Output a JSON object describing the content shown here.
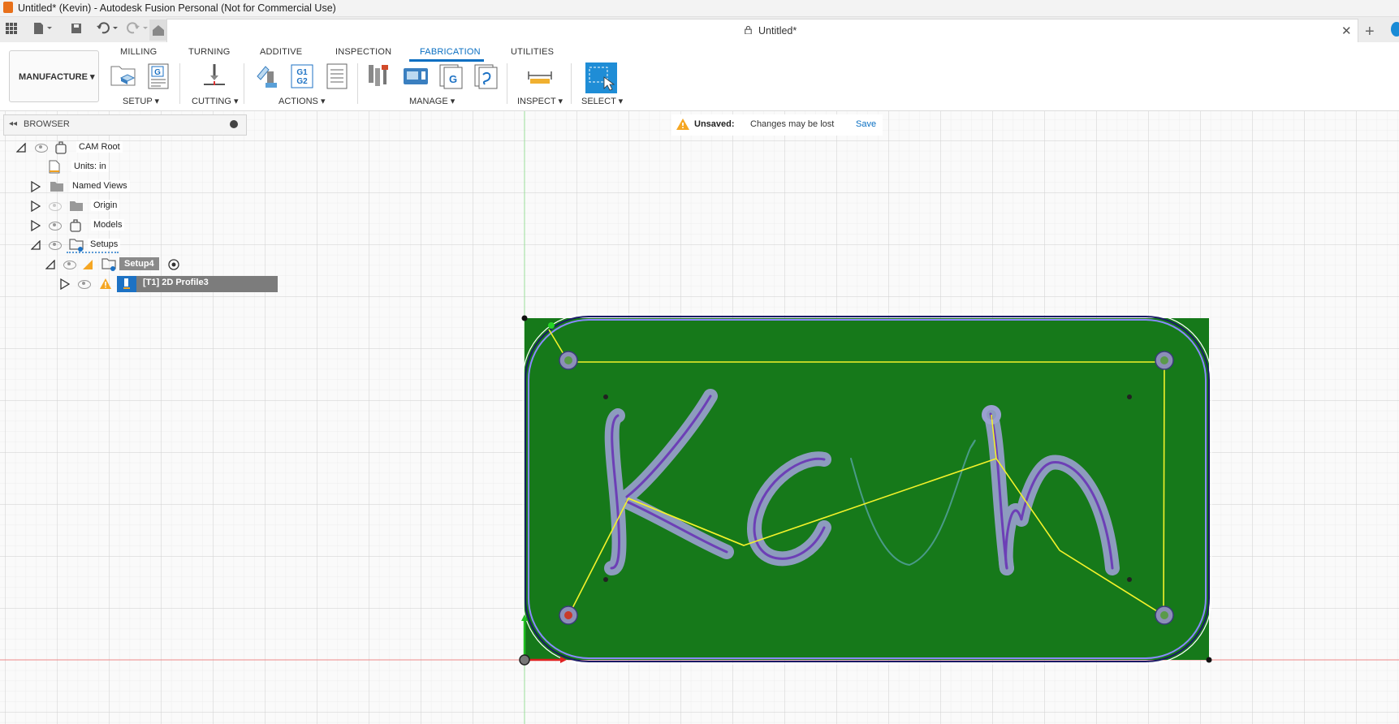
{
  "window": {
    "title": "Untitled* (Kevin) - Autodesk Fusion Personal (Not for Commercial Use)"
  },
  "document": {
    "tab_name": "Untitled*"
  },
  "workspace": {
    "label": "MANUFACTURE"
  },
  "ribbon": {
    "tabs": [
      {
        "label": "MILLING"
      },
      {
        "label": "TURNING"
      },
      {
        "label": "ADDITIVE"
      },
      {
        "label": "INSPECTION"
      },
      {
        "label": "FABRICATION"
      },
      {
        "label": "UTILITIES"
      }
    ],
    "active_tab": "FABRICATION",
    "groups": {
      "setup": "SETUP ▾",
      "cutting": "CUTTING ▾",
      "actions": "ACTIONS ▾",
      "manage": "MANAGE ▾",
      "inspect": "INSPECT ▾",
      "select": "SELECT ▾"
    },
    "g1g2_text": [
      "G1",
      "G2"
    ],
    "g_text": "G"
  },
  "browser": {
    "title": "BROWSER",
    "nodes": {
      "cam_root": "CAM Root",
      "units": "Units: in",
      "named_views": "Named Views",
      "origin": "Origin",
      "models": "Models",
      "setups": "Setups",
      "setup4": "Setup4",
      "profile": "[T1] 2D Profile3"
    }
  },
  "notice": {
    "label": "Unsaved:",
    "message": "Changes may be lost",
    "action": "Save"
  },
  "colors": {
    "accent": "#0a6fc2",
    "stock_green": "#16791a",
    "toolpath_yellow": "#f2f22a",
    "warning": "#f5a623"
  },
  "icons": [
    "apps-grid-icon",
    "file-icon",
    "save-icon",
    "undo-icon",
    "redo-icon",
    "home-icon",
    "lock-icon",
    "close-icon",
    "new-tab-icon",
    "warning-icon",
    "eye-icon",
    "folder-icon",
    "component-icon"
  ]
}
